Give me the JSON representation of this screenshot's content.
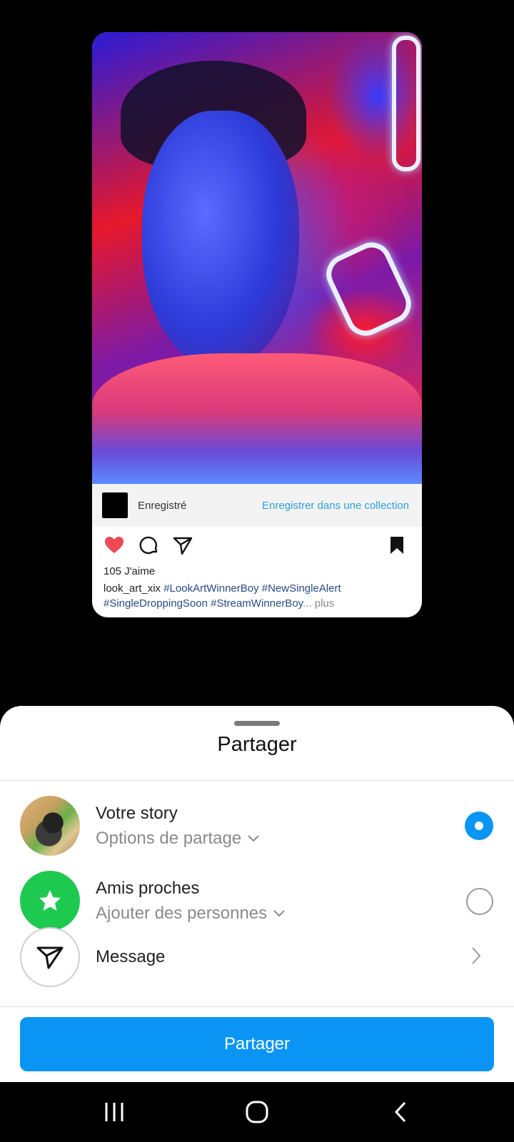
{
  "post": {
    "saved_label": "Enregistré",
    "save_to_collection": "Enregistrer dans une collection",
    "likes": "105 J'aime",
    "caption_user": "look_art_xix",
    "caption_tags_line1": "#LookArtWinnerBoy #NewSingleAlert",
    "caption_tags_line2": "#SingleDroppingSoon #StreamWinnerBoy",
    "caption_ellipsis": "...",
    "caption_more": "plus",
    "like_color": "#ed4956",
    "icons": [
      "heart-icon",
      "comment-icon",
      "send-icon",
      "bookmark-icon"
    ]
  },
  "sheet": {
    "title": "Partager",
    "rows": [
      {
        "title": "Votre story",
        "subtitle": "Options de partage",
        "selected": true
      },
      {
        "title": "Amis proches",
        "subtitle": "Ajouter des personnes",
        "selected": false
      },
      {
        "title": "Message"
      }
    ],
    "share_button": "Partager",
    "accent_color": "#0a95f5",
    "close_friends_color": "#1ec94f"
  },
  "navbar": {
    "icons": [
      "recent-apps-icon",
      "home-icon",
      "back-icon"
    ]
  }
}
